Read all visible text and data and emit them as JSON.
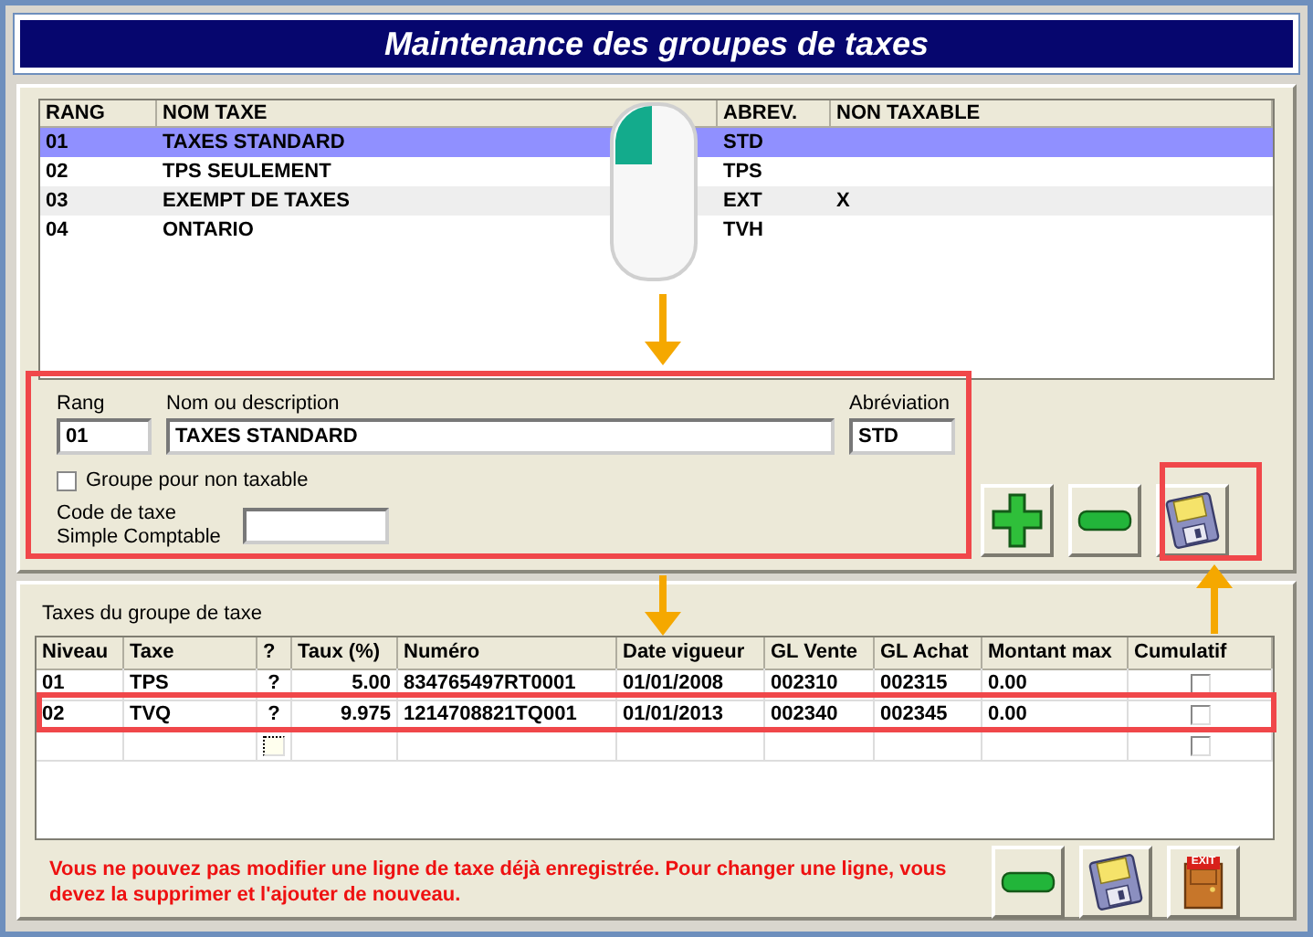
{
  "title": "Maintenance des groupes de taxes",
  "groups": {
    "columns": [
      "RANG",
      "NOM TAXE",
      "ABREV.",
      "NON TAXABLE"
    ],
    "rows": [
      {
        "rang": "01",
        "nom": "TAXES STANDARD",
        "abrev": "STD",
        "selected": true
      },
      {
        "rang": "02",
        "nom": "TPS SEULEMENT",
        "abrev": "TPS",
        "selected": false
      },
      {
        "rang": "03",
        "nom": "EXEMPT DE TAXES",
        "abrev": "EXT",
        "non_taxable": "X",
        "selected": false
      },
      {
        "rang": "04",
        "nom": "ONTARIO",
        "abrev": "TVH",
        "selected": false
      }
    ]
  },
  "form": {
    "rang_label": "Rang",
    "rang_value": "01",
    "name_label": "Nom ou description",
    "name_value": "TAXES STANDARD",
    "abrev_label": "Abréviation",
    "abrev_value": "STD",
    "non_taxable": {
      "label": "Groupe pour non taxable",
      "checked": false
    },
    "code_label": "Code de taxe\nSimple Comptable"
  },
  "top_buttons": [
    {
      "kind": "add"
    },
    {
      "kind": "remove"
    },
    {
      "kind": "save"
    }
  ],
  "taxes": {
    "label": "Taxes du groupe de taxe",
    "columns": [
      "Niveau",
      "Taxe",
      "?",
      "Taux (%)",
      "Numéro",
      "Date vigueur",
      "GL Vente",
      "GL Achat",
      "Montant max",
      "Cumulatif"
    ],
    "rows": [
      {
        "niveau": "01",
        "taxe": "TPS",
        "flag": "?",
        "taux": "5.00",
        "numero": "834765497RT0001",
        "date": "01/01/2008",
        "gl_vente": "002310",
        "gl_achat": "002315",
        "montant": "0.00",
        "cumulatif": false
      },
      {
        "niveau": "02",
        "taxe": "TVQ",
        "flag": "?",
        "taux": "9.975",
        "numero": "1214708821TQ001",
        "date": "01/01/2013",
        "gl_vente": "002340",
        "gl_achat": "002345",
        "montant": "0.00",
        "cumulatif": false
      },
      {
        "kind": "empty",
        "cumulatif": false
      }
    ]
  },
  "message": "Vous ne pouvez pas modifier une ligne de taxe déjà enregistrée. Pour changer une ligne, vous devez la supprimer et l'ajouter de nouveau.",
  "bottom_buttons": [
    {
      "kind": "remove"
    },
    {
      "kind": "save"
    },
    {
      "kind": "exit",
      "sign": "EXIT"
    }
  ]
}
